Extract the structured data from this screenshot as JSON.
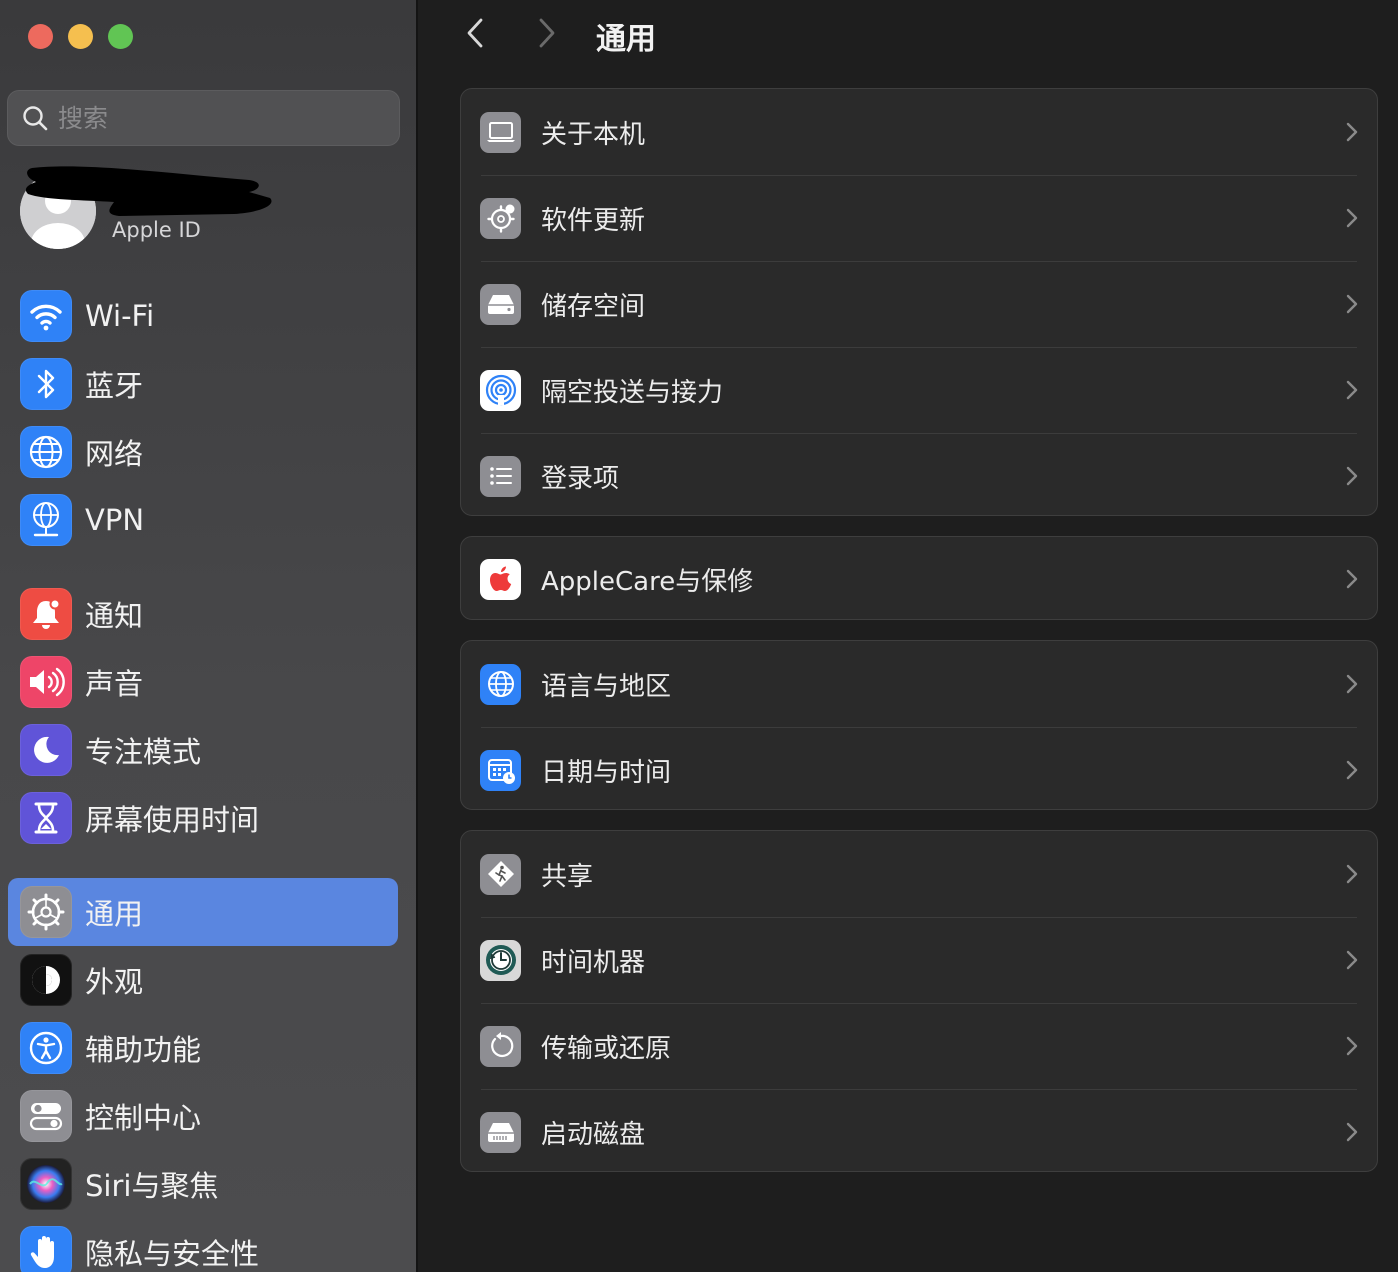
{
  "window": {
    "title": "通用"
  },
  "search": {
    "placeholder": "搜索"
  },
  "account": {
    "name": "",
    "subtitle": "Apple ID"
  },
  "sidebar": {
    "items": [
      {
        "label": "Wi-Fi",
        "icon": "wifi-icon",
        "color": "#2f82f7"
      },
      {
        "label": "蓝牙",
        "icon": "bluetooth-icon",
        "color": "#2f82f7"
      },
      {
        "label": "网络",
        "icon": "globe-icon",
        "color": "#2f82f7"
      },
      {
        "label": "VPN",
        "icon": "vpn-globe-icon",
        "color": "#2f82f7"
      },
      {
        "label": "通知",
        "icon": "bell-icon",
        "color": "#ee4c43"
      },
      {
        "label": "声音",
        "icon": "speaker-icon",
        "color": "#ee4568"
      },
      {
        "label": "专注模式",
        "icon": "moon-icon",
        "color": "#6054d8"
      },
      {
        "label": "屏幕使用时间",
        "icon": "hourglass-icon",
        "color": "#6054d8"
      },
      {
        "label": "通用",
        "icon": "gear-icon",
        "color": "#8e8e93",
        "selected": true
      },
      {
        "label": "外观",
        "icon": "appearance-icon",
        "color": "#111111"
      },
      {
        "label": "辅助功能",
        "icon": "accessibility-icon",
        "color": "#2f82f7"
      },
      {
        "label": "控制中心",
        "icon": "toggles-icon",
        "color": "#8e8e93"
      },
      {
        "label": "Siri与聚焦",
        "icon": "siri-icon",
        "color": "#222222"
      },
      {
        "label": "隐私与安全性",
        "icon": "hand-icon",
        "color": "#2f82f7"
      }
    ]
  },
  "main": {
    "title": "通用",
    "groups": [
      {
        "rows": [
          {
            "label": "关于本机",
            "icon": "laptop-icon"
          },
          {
            "label": "软件更新",
            "icon": "gear-badge-icon"
          },
          {
            "label": "储存空间",
            "icon": "drive-icon"
          },
          {
            "label": "隔空投送与接力",
            "icon": "airdrop-icon"
          },
          {
            "label": "登录项",
            "icon": "list-icon"
          }
        ]
      },
      {
        "rows": [
          {
            "label": "AppleCare与保修",
            "icon": "apple-logo-icon"
          }
        ]
      },
      {
        "rows": [
          {
            "label": "语言与地区",
            "icon": "globe-icon"
          },
          {
            "label": "日期与时间",
            "icon": "calendar-clock-icon"
          }
        ]
      },
      {
        "rows": [
          {
            "label": "共享",
            "icon": "sharing-icon"
          },
          {
            "label": "时间机器",
            "icon": "time-machine-icon"
          },
          {
            "label": "传输或还原",
            "icon": "restore-icon"
          },
          {
            "label": "启动磁盘",
            "icon": "startup-disk-icon"
          }
        ]
      }
    ]
  },
  "colors": {
    "accent": "#5a86e0",
    "sidebar_bg": "#3a3a3c",
    "content_bg": "#1e1e1e",
    "group_bg": "#2a2a2a",
    "close": "#ed6a5e",
    "minimize": "#f5bf4f",
    "maximize": "#61c554"
  }
}
